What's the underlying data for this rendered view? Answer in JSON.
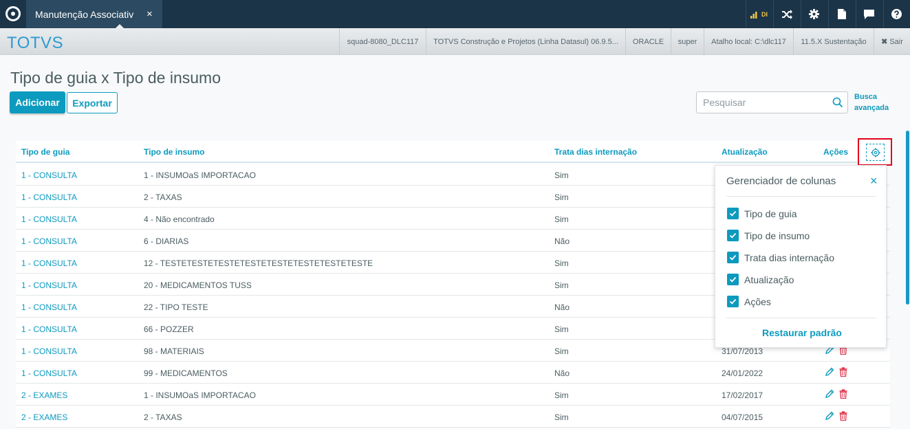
{
  "topbar": {
    "tab_label": "Manutenção Associativ",
    "tab_close": "×",
    "icons": [
      "signal-icon",
      "shuffle-icon",
      "gear-icon",
      "document-icon",
      "chat-icon",
      "help-icon"
    ],
    "signal_label": "DI"
  },
  "infobar": {
    "brand": "TOTVS",
    "items": [
      "squad-8080_DLC117",
      "TOTVS Construção e Projetos (Linha Datasul) 06.9.5...",
      "ORACLE",
      "super",
      "Atalho local: C:\\dlc117",
      "11.5.X Sustentação"
    ],
    "logout": "Sair"
  },
  "page": {
    "title": "Tipo de guia x Tipo de insumo",
    "add_label": "Adicionar",
    "export_label": "Exportar",
    "search_placeholder": "Pesquisar",
    "advanced_line1": "Busca",
    "advanced_line2": "avançada"
  },
  "table": {
    "headers": [
      "Tipo de guia",
      "Tipo de insumo",
      "Trata dias internação",
      "Atualização",
      "Ações"
    ],
    "rows": [
      {
        "guia": "1 - CONSULTA",
        "insumo": "1 - INSUMOaS IMPORTACAO",
        "trata": "Sim",
        "atualizacao": "",
        "actions": false
      },
      {
        "guia": "1 - CONSULTA",
        "insumo": "2 - TAXAS",
        "trata": "Sim",
        "atualizacao": "",
        "actions": false
      },
      {
        "guia": "1 - CONSULTA",
        "insumo": "4 - Não encontrado",
        "trata": "Sim",
        "atualizacao": "",
        "actions": false
      },
      {
        "guia": "1 - CONSULTA",
        "insumo": "6 - DIARIAS",
        "trata": "Não",
        "atualizacao": "",
        "actions": false
      },
      {
        "guia": "1 - CONSULTA",
        "insumo": "12 - TESTETESTETESTETESTETESTETESTETESTETESTE",
        "trata": "Sim",
        "atualizacao": "",
        "actions": false
      },
      {
        "guia": "1 - CONSULTA",
        "insumo": "20 - MEDICAMENTOS TUSS",
        "trata": "Sim",
        "atualizacao": "",
        "actions": false
      },
      {
        "guia": "1 - CONSULTA",
        "insumo": "22 - TIPO TESTE",
        "trata": "Não",
        "atualizacao": "",
        "actions": false
      },
      {
        "guia": "1 - CONSULTA",
        "insumo": "66 - POZZER",
        "trata": "Sim",
        "atualizacao": "",
        "actions": false
      },
      {
        "guia": "1 - CONSULTA",
        "insumo": "98 - MATERIAIS",
        "trata": "Sim",
        "atualizacao": "31/07/2013",
        "actions": true
      },
      {
        "guia": "1 - CONSULTA",
        "insumo": "99 - MEDICAMENTOS",
        "trata": "Não",
        "atualizacao": "24/01/2022",
        "actions": true
      },
      {
        "guia": "2 - EXAMES",
        "insumo": "1 - INSUMOaS IMPORTACAO",
        "trata": "Sim",
        "atualizacao": "17/02/2017",
        "actions": true
      },
      {
        "guia": "2 - EXAMES",
        "insumo": "2 - TAXAS",
        "trata": "Sim",
        "atualizacao": "04/07/2015",
        "actions": true
      }
    ]
  },
  "column_manager": {
    "title": "Gerenciador de colunas",
    "close": "×",
    "columns": [
      "Tipo de guia",
      "Tipo de insumo",
      "Trata dias internação",
      "Atualização",
      "Ações"
    ],
    "restore_label": "Restaurar padrão"
  },
  "colors": {
    "accent": "#0c9abe",
    "topbar": "#1c3448",
    "highlight_border": "#e0001b",
    "delete": "#e0334b"
  }
}
